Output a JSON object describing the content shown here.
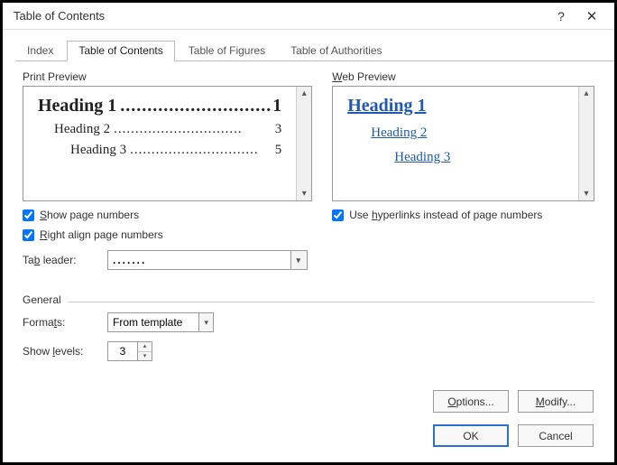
{
  "title": "Table of Contents",
  "tabs": {
    "index": "Index",
    "toc": "Table of Contents",
    "tof": "Table of Figures",
    "toa": "Table of Authorities"
  },
  "print_preview": {
    "label_prefix": "P",
    "label_rest": "rint Preview",
    "h1": {
      "text": "Heading 1",
      "page": "1"
    },
    "h2": {
      "text": "Heading 2",
      "page": "3"
    },
    "h3": {
      "text": "Heading 3",
      "page": "5"
    },
    "leaders": ".............................."
  },
  "web_preview": {
    "label_ul": "W",
    "label_rest": "eb Preview",
    "h1": "Heading 1",
    "h2": "Heading 2",
    "h3": "Heading 3"
  },
  "checkboxes": {
    "show_pn_ul": "S",
    "show_pn_rest": "how page numbers",
    "right_align_ul": "R",
    "right_align_rest": "ight align page numbers",
    "hyperlinks_pre": "Use ",
    "hyperlinks_ul": "h",
    "hyperlinks_rest": "yperlinks instead of page numbers"
  },
  "tab_leader": {
    "label_pre": "Ta",
    "label_ul": "b",
    "label_rest": " leader:",
    "value": "......."
  },
  "general": {
    "label": "General",
    "formats_label_pre": "Forma",
    "formats_label_ul": "t",
    "formats_label_rest": "s:",
    "formats_value": "From template",
    "levels_label_pre": "Show ",
    "levels_label_ul": "l",
    "levels_label_rest": "evels:",
    "levels_value": "3"
  },
  "buttons": {
    "options_ul": "O",
    "options_rest": "ptions...",
    "modify_ul": "M",
    "modify_rest": "odify...",
    "ok": "OK",
    "cancel": "Cancel"
  }
}
